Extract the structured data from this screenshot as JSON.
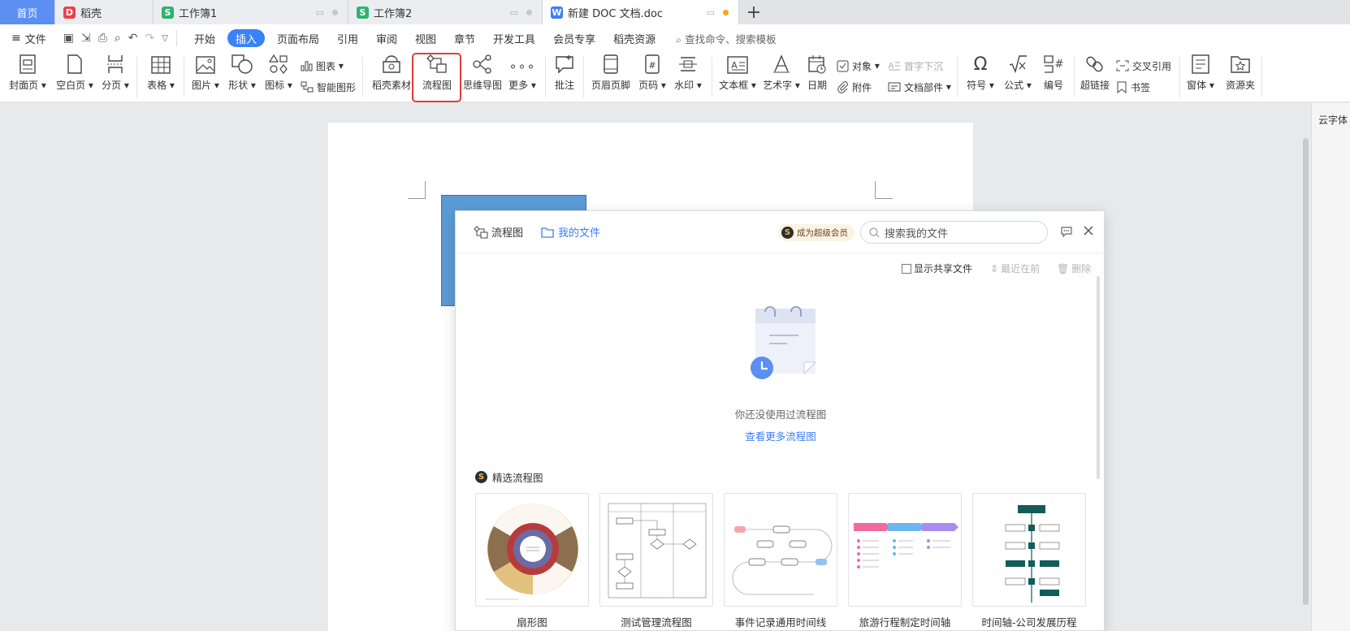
{
  "tabs": {
    "home": "首页",
    "t1": "稻壳",
    "t2": "工作簿1",
    "t3": "工作簿2",
    "t4": "新建 DOC 文档.doc"
  },
  "menu": {
    "file": "文件",
    "items": [
      "开始",
      "插入",
      "页面布局",
      "引用",
      "审阅",
      "视图",
      "章节",
      "开发工具",
      "会员专享",
      "稻壳资源"
    ],
    "active": "插入",
    "search": "查找命令、搜索模板"
  },
  "ribbon": {
    "cover": "封面页",
    "blank": "空白页",
    "pagebreak": "分页",
    "table": "表格",
    "picture": "图片",
    "shape": "形状",
    "icon": "图标",
    "chart": "图表",
    "smartart": "智能图形",
    "docer": "稻壳素材",
    "flowchart": "流程图",
    "mindmap": "思维导图",
    "more": "更多",
    "comment": "批注",
    "headerfooter": "页眉页脚",
    "pagenum": "页码",
    "watermark": "水印",
    "textbox": "文本框",
    "wordart": "艺术字",
    "date": "日期",
    "object": "对象",
    "attachment": "附件",
    "dropcap": "首字下沉",
    "docpart": "文档部件",
    "symbol": "符号",
    "formula": "公式",
    "numbering": "编号",
    "hyperlink": "超链接",
    "crossref": "交叉引用",
    "bookmark": "书签",
    "window": "窗体",
    "resources": "资源夹"
  },
  "right_panel": "云字体",
  "dialog": {
    "title": "流程图",
    "my_files": "我的文件",
    "vip": "成为超级会员",
    "search_placeholder": "搜索我的文件",
    "show_shared": "显示共享文件",
    "sort": "最近在前",
    "delete": "删除",
    "empty_text": "你还没使用过流程图",
    "more_link": "查看更多流程图",
    "featured": "精选流程图",
    "templates": [
      "扇形图",
      "测试管理流程图",
      "事件记录通用时间线",
      "旅游行程制定时间轴",
      "时间轴-公司发展历程"
    ]
  },
  "colors": {
    "accent": "#3b82f6",
    "highlight": "#e03c3c",
    "shape_fill": "#5b9bd5"
  }
}
